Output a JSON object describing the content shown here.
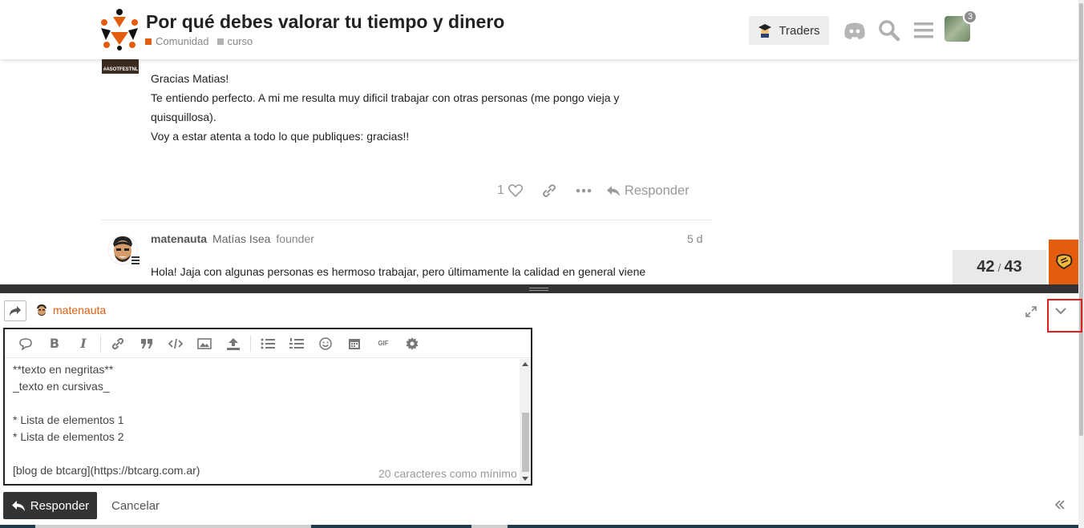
{
  "header": {
    "topic_title": "Por qué debes valorar tu tiempo y dinero",
    "categories": [
      {
        "name": "Comunidad",
        "color": "#e45d0f"
      },
      {
        "name": "curso",
        "color": "#b3b3b3"
      }
    ],
    "traders_label": "Traders",
    "notification_count": "3"
  },
  "post1": {
    "avatar_caption": "#ASOTFESTNL",
    "lines": [
      "Gracias Matias!",
      "Te entiendo perfecto. A mi me resulta muy dificil trabajar con otras personas (me pongo vieja y",
      "quisquillosa).",
      "Voy a estar atenta a todo lo que publiques: gracias!!"
    ],
    "like_count": "1",
    "reply_label": "Responder"
  },
  "post2": {
    "username": "matenauta",
    "full_name": "Matías Isea",
    "title": "founder",
    "date": "5 d",
    "text": "Hola! Jaja con algunas personas es hermoso trabajar, pero últimamente la calidad en general viene"
  },
  "timeline": {
    "current": "42",
    "separator": "/",
    "total": "43"
  },
  "composer": {
    "reply_to_user": "matenauta",
    "editor_lines": [
      "**texto en negritas**",
      "_texto en cursivas_",
      "",
      "* Lista de elementos 1",
      "* Lista de elementos 2",
      "",
      "[blog de btcarg](https://btcarg.com.ar)"
    ],
    "min_chars_hint": "20 caracteres como mínimo",
    "submit_label": "Responder",
    "cancel_label": "Cancelar",
    "gif_label": "GIF"
  },
  "colors": {
    "accent": "#e45d0f",
    "highlight_box": "#e01e1e",
    "dark": "#333333"
  }
}
